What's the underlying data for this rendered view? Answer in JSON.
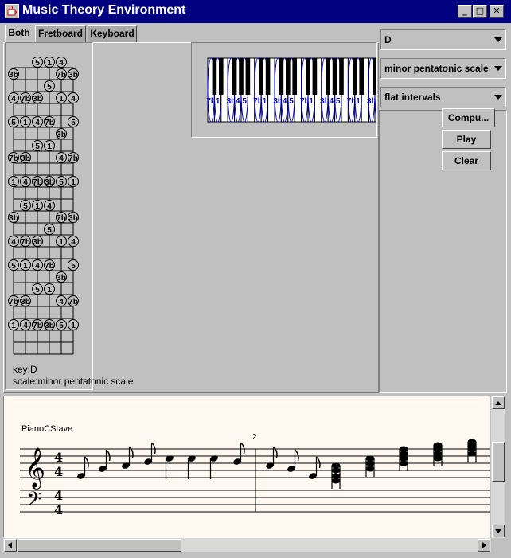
{
  "window": {
    "title": "Music Theory Environment",
    "controls": {
      "minimize": "_",
      "maximize": "□",
      "close": "✕"
    }
  },
  "tabs": [
    {
      "label": "Both",
      "selected": true
    },
    {
      "label": "Fretboard",
      "selected": false
    },
    {
      "label": "Keyboard",
      "selected": false
    }
  ],
  "fretboard": {
    "strings": 6,
    "rows": [
      [
        "",
        "",
        "5",
        "1",
        "4",
        ""
      ],
      [
        "3b",
        "",
        "",
        "",
        "7b",
        "3b"
      ],
      [
        "",
        "",
        "",
        "5",
        "",
        ""
      ],
      [
        "4",
        "7b",
        "3b",
        "",
        "1",
        "4"
      ],
      [
        "",
        "",
        "",
        "",
        "",
        ""
      ],
      [
        "5",
        "1",
        "4",
        "7b",
        "",
        "5"
      ],
      [
        "",
        "",
        "",
        "",
        "3b",
        ""
      ],
      [
        "",
        "",
        "5",
        "1",
        "",
        ""
      ],
      [
        "7b",
        "3b",
        "",
        "",
        "4",
        "7b"
      ],
      [
        "",
        "",
        "",
        "",
        "",
        ""
      ],
      [
        "1",
        "4",
        "7b",
        "3b",
        "5",
        "1"
      ],
      [
        "",
        "",
        "",
        "",
        "",
        ""
      ],
      [
        "",
        "5",
        "1",
        "4",
        "",
        ""
      ],
      [
        "3b",
        "",
        "",
        "",
        "7b",
        "3b"
      ],
      [
        "",
        "",
        "",
        "5",
        "",
        ""
      ],
      [
        "4",
        "7b",
        "3b",
        "",
        "1",
        "4"
      ],
      [
        "",
        "",
        "",
        "",
        "",
        ""
      ],
      [
        "5",
        "1",
        "4",
        "7b",
        "",
        "5"
      ],
      [
        "",
        "",
        "",
        "",
        "3b",
        ""
      ],
      [
        "",
        "",
        "5",
        "1",
        "",
        ""
      ],
      [
        "7b",
        "3b",
        "",
        "",
        "4",
        "7b"
      ],
      [
        "",
        "",
        "",
        "",
        "",
        ""
      ],
      [
        "1",
        "4",
        "7b",
        "3b",
        "5",
        "1"
      ],
      [
        "",
        "",
        "",
        "",
        "",
        ""
      ]
    ]
  },
  "keyboard": {
    "octaves": 4,
    "white_key_labels": [
      "7b",
      "1",
      "",
      "3b",
      "4",
      "5",
      "",
      "7b",
      "1",
      "",
      "3b",
      "4",
      "5",
      ""
    ]
  },
  "info": {
    "key_line": "key:D",
    "scale_line": "scale:minor pentatonic scale"
  },
  "controls": {
    "key_select": "D",
    "scale_select": "minor pentatonic scale",
    "interval_select": "flat intervals",
    "compute_label": "Compu...",
    "play_label": "Play",
    "clear_label": "Clear"
  },
  "score": {
    "stave_label": "PianoCStave",
    "measure_number": "2",
    "time_signature": [
      "4",
      "4"
    ]
  },
  "colors": {
    "titlebar": "#000080",
    "window_bg": "#c0c0c0",
    "score_bg": "#fff8f0",
    "scale_note": "#0000cc"
  }
}
